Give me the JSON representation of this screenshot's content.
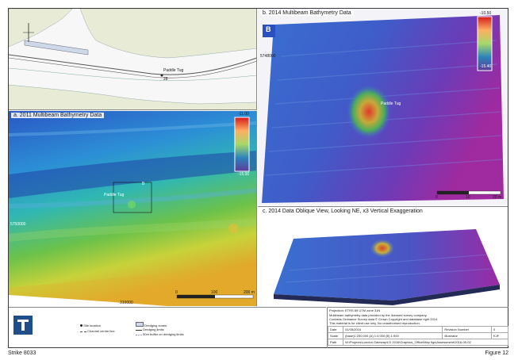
{
  "panels": {
    "map": {
      "feature_label": "Paddle Tug",
      "feature_number": "28"
    },
    "a": {
      "title": "a. 2011 Multibeam Bathymetry Data",
      "feature_label": "Paddle Tug",
      "inset_mark": "B",
      "grid_left_label": "5750000",
      "grid_bottom_label": "310000",
      "scale_labels": [
        "0",
        "100",
        "200 m"
      ],
      "colorbar_top": "-11.00",
      "colorbar_bottom": "-15.00"
    },
    "b": {
      "title": "b. 2014 Multibeam Bathymetry Data",
      "corner_letter": "B",
      "feature_label": "Paddle Tug",
      "left_label": "5748000",
      "scale_labels": [
        "0",
        "10",
        "20 m"
      ],
      "colorbar_top": "-10.50",
      "colorbar_bottom": "-15.40"
    },
    "c": {
      "title": "c. 2014 Data Oblique View, Looking NE, x3 Vertical Exaggeration"
    }
  },
  "legend": {
    "items": [
      "Site location",
      "Channel centre line",
      "Dredging zones",
      "Dredging limits",
      "50m buffer on dredging limits"
    ]
  },
  "info": {
    "projection": "Projection: ETRS 89 UTM zone 31N",
    "notes": [
      "Multibeam bathymetry data provided by the licensed survey company.",
      "Contains Ordnance Survey data © Crown Copyright and database right 2014.",
      "This material is for client use only. No unauthorised reproduction."
    ],
    "rows": [
      {
        "k": "Date",
        "v": "01/05/2016",
        "k2": "Revision Number",
        "v2": "0"
      },
      {
        "k": "Scale",
        "v": "(base)1:250,000 (A) 1:4,000 (B) 1:500",
        "k2": "Illustrator",
        "v2": "KJF"
      },
      {
        "k": "Path",
        "v": "W:\\Projects\\London Gateway\\LG 2016\\Graphics_Office\\Map figs\\Assessment\\2016-05-02",
        "k2": "",
        "v2": ""
      }
    ]
  },
  "footer": {
    "left": "Strike 8033",
    "right": "Figure 12"
  }
}
